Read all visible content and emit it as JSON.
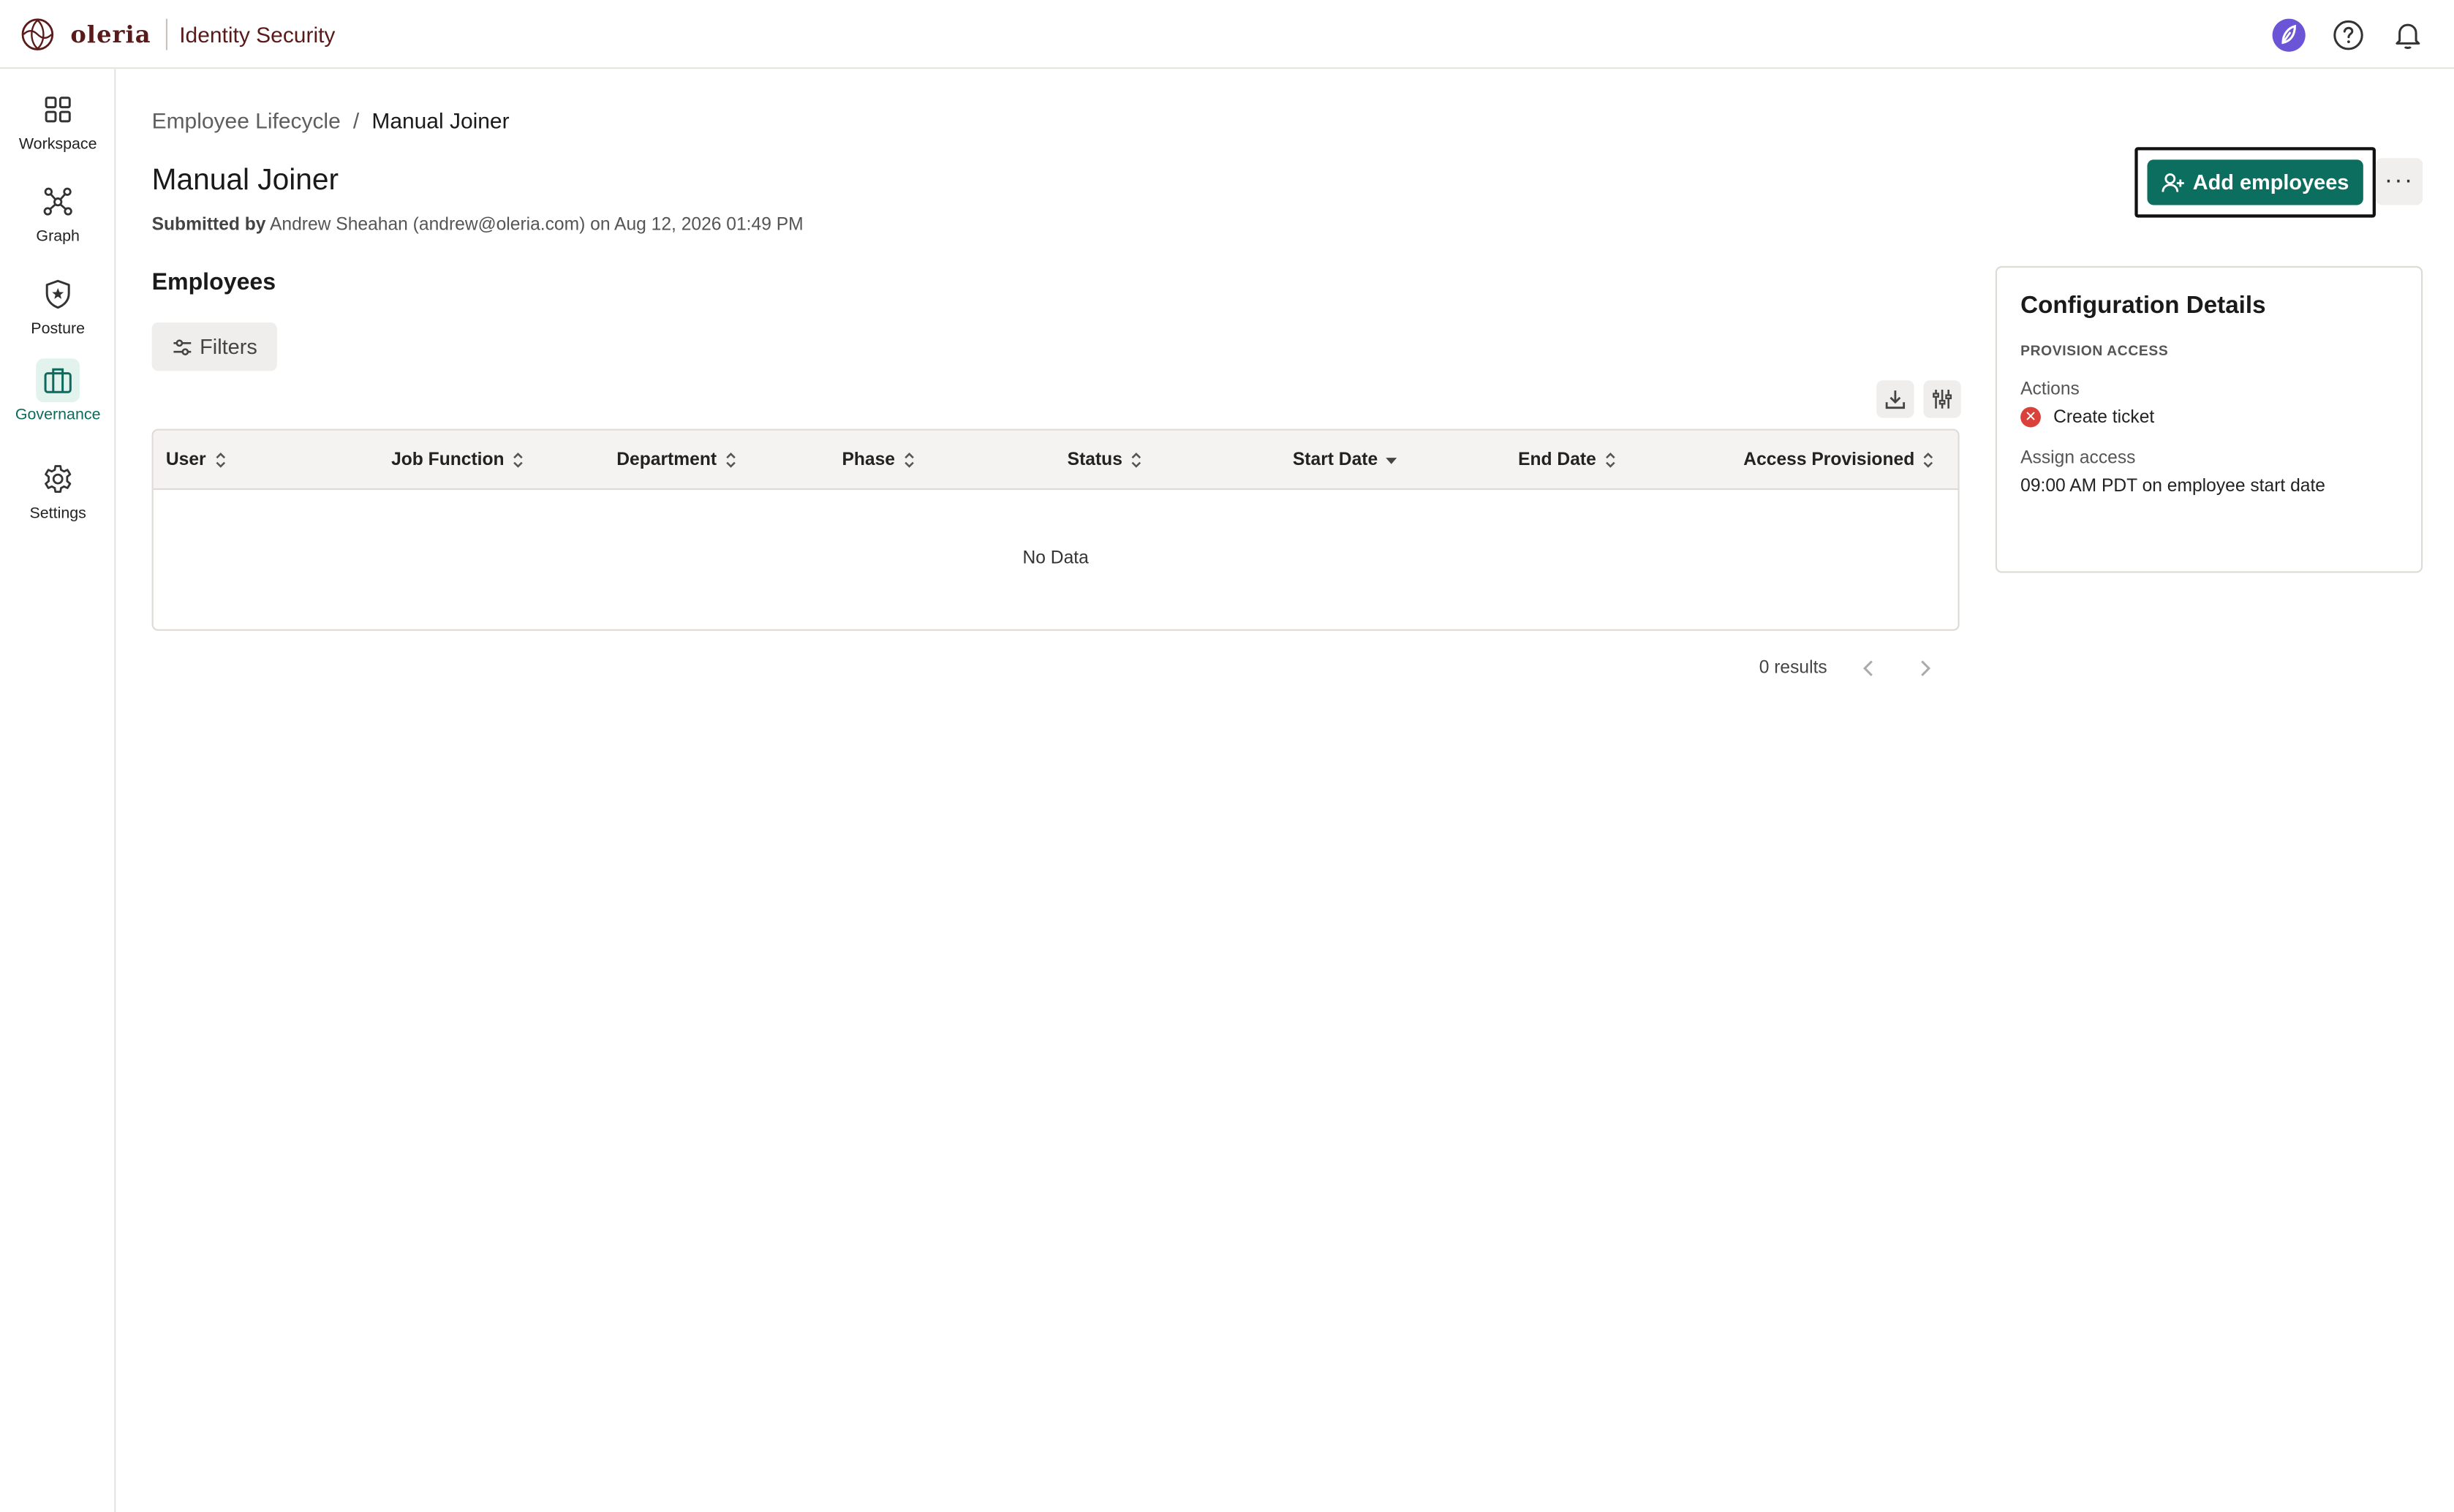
{
  "app": {
    "brand": "oleria",
    "product": "Identity Security"
  },
  "colors": {
    "accent": "#0b6e5e",
    "brand": "#5a1a1a",
    "error": "#d9413a",
    "avatar": "#6b54d6"
  },
  "sidebar": {
    "items": [
      {
        "label": "Workspace",
        "icon": "grid-icon"
      },
      {
        "label": "Graph",
        "icon": "graph-icon"
      },
      {
        "label": "Posture",
        "icon": "shield-icon"
      },
      {
        "label": "Governance",
        "icon": "briefcase-icon",
        "active": true
      },
      {
        "label": "Settings",
        "icon": "gear-icon"
      }
    ]
  },
  "breadcrumb": {
    "parent": "Employee Lifecycle",
    "separator": "/",
    "current": "Manual Joiner"
  },
  "header": {
    "title": "Manual Joiner",
    "submitted_by_label": "Submitted by",
    "submitted_by_text": "Andrew Sheahan (andrew@oleria.com) on Aug 12, 2026 01:49 PM",
    "add_button": "Add employees",
    "more_button": "···"
  },
  "employees": {
    "title": "Employees",
    "filters_label": "Filters",
    "columns": [
      {
        "label": "User",
        "sort": "none"
      },
      {
        "label": "Job Function",
        "sort": "none"
      },
      {
        "label": "Department",
        "sort": "none"
      },
      {
        "label": "Phase",
        "sort": "none"
      },
      {
        "label": "Status",
        "sort": "none"
      },
      {
        "label": "Start Date",
        "sort": "desc"
      },
      {
        "label": "End Date",
        "sort": "none"
      },
      {
        "label": "Access Provisioned",
        "sort": "none"
      }
    ],
    "empty_text": "No Data",
    "results_text": "0 results"
  },
  "config": {
    "title": "Configuration Details",
    "section": "PROVISION ACCESS",
    "actions_label": "Actions",
    "action_item": "Create ticket",
    "assign_label": "Assign access",
    "assign_value": "09:00 AM PDT on employee start date"
  }
}
